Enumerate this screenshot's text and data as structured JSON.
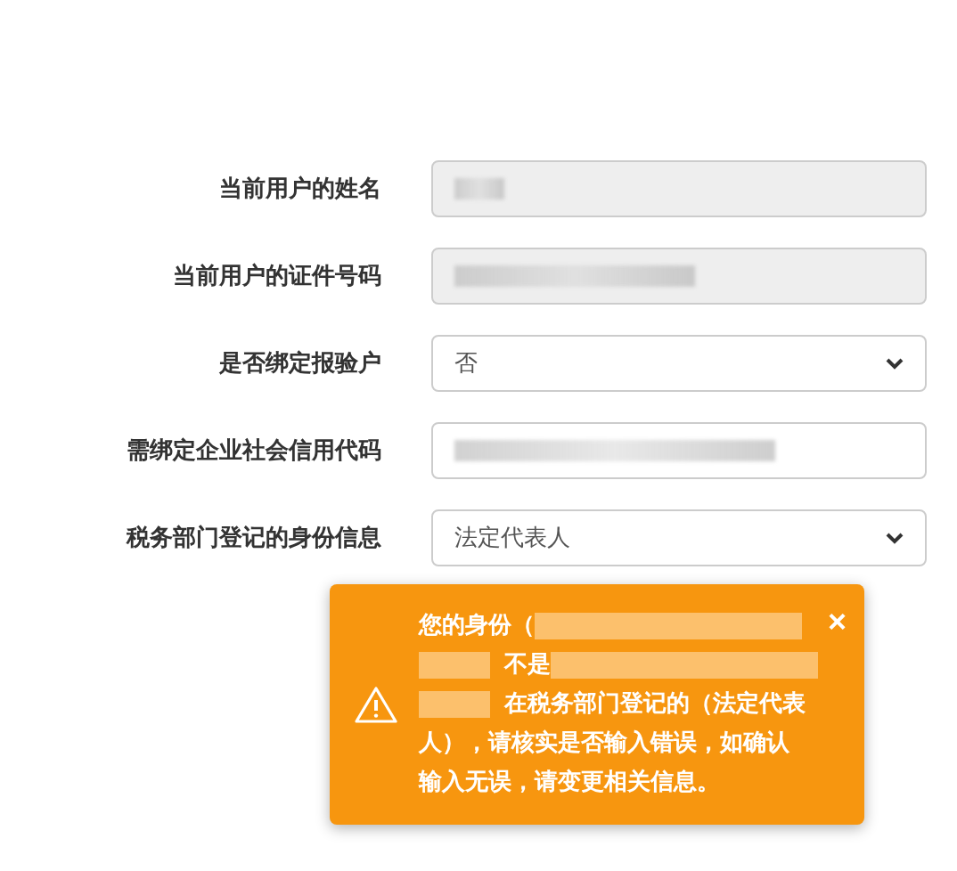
{
  "form": {
    "fields": [
      {
        "label": "当前用户的姓名",
        "kind": "text",
        "disabled": true,
        "redacted": true
      },
      {
        "label": "当前用户的证件号码",
        "kind": "text",
        "disabled": true,
        "redacted": true
      },
      {
        "label": "是否绑定报验户",
        "kind": "select",
        "disabled": false,
        "value": "否"
      },
      {
        "label": "需绑定企业社会信用代码",
        "kind": "text",
        "disabled": false,
        "redacted": true
      },
      {
        "label": "税务部门登记的身份信息",
        "kind": "select",
        "disabled": false,
        "value": "法定代表人"
      }
    ]
  },
  "alert": {
    "close": "×",
    "lines": [
      [
        {
          "kind": "text",
          "text": "您的身份（"
        },
        {
          "kind": "redacted-wide"
        }
      ],
      [
        {
          "kind": "redacted-small"
        },
        {
          "kind": "text",
          "text": "不是"
        },
        {
          "kind": "redacted-wide"
        }
      ],
      [
        {
          "kind": "redacted-small"
        },
        {
          "kind": "text",
          "text": "在税务部门登记的（法定代表"
        }
      ],
      [
        {
          "kind": "text",
          "text": "人），请核实是否输入错误，如确认"
        }
      ],
      [
        {
          "kind": "text",
          "text": "输入无误，请变更相关信息。"
        }
      ]
    ]
  }
}
